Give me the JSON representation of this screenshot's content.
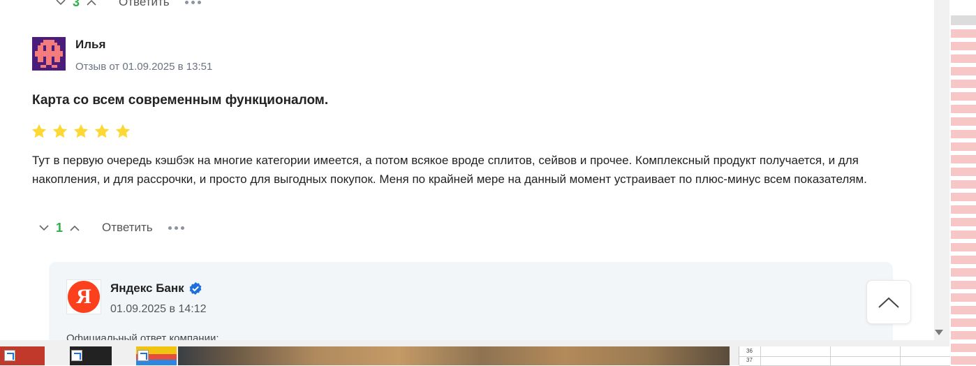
{
  "top_actions": {
    "count": "3",
    "reply_label": "Ответить"
  },
  "review": {
    "author": "Илья",
    "meta": "Отзыв от 01.09.2025 в 13:51",
    "title": "Карта со всем современным функционалом.",
    "rating": 5,
    "rating_max": 5,
    "star_color": "#fdd835",
    "text": "Тут в первую очередь кэшбэк на многие категории имеется, а потом всякое вроде сплитов, сейвов и прочее. Комплексный продукт получается, и для накопления, и для рассрочки, и просто для выгодных покупок. Меня по крайней мере на данный момент устраивает по плюс-минус всем показателям.",
    "count": "1",
    "reply_label": "Ответить"
  },
  "company_reply": {
    "logo_letter": "Я",
    "logo_color": "#fc3f1d",
    "name": "Яндекс Банк",
    "verified_icon": "verified-badge-icon",
    "date": "01.09.2025 в 14:12",
    "official_label": "Официальный ответ компании:"
  },
  "spreadsheet_rows": [
    "36",
    "37"
  ],
  "colors": {
    "vote_count": "#2bb14a",
    "verified": "#1e6fd9",
    "reply_bg": "#f3f6f9"
  }
}
